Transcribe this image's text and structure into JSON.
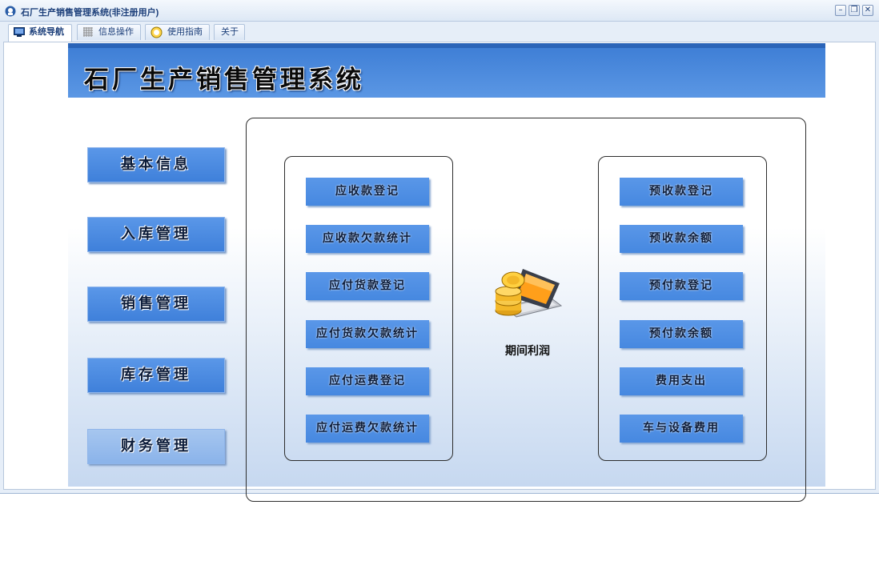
{
  "window": {
    "title": "石厂生产销售管理系统(非注册用户)",
    "controls": [
      "minimize-icon",
      "restore-icon",
      "close-icon"
    ]
  },
  "menu": {
    "tabs": [
      {
        "label": "系统导航",
        "icon": "monitor-icon",
        "active": true
      },
      {
        "label": "信息操作",
        "icon": "grid-icon",
        "active": false
      },
      {
        "label": "使用指南",
        "icon": "help-icon",
        "active": false
      },
      {
        "label": "关于",
        "icon": "",
        "active": false
      }
    ]
  },
  "banner": {
    "title": "石厂生产销售管理系统"
  },
  "sidebar": {
    "items": [
      {
        "label": "基本信息"
      },
      {
        "label": "入库管理"
      },
      {
        "label": "销售管理"
      },
      {
        "label": "库存管理"
      },
      {
        "label": "财务管理",
        "selected": true
      }
    ]
  },
  "finance": {
    "left_items": [
      {
        "label": "应收款登记"
      },
      {
        "label": "应收款欠款统计"
      },
      {
        "label": "应付货款登记"
      },
      {
        "label": "应付货款欠款统计"
      },
      {
        "label": "应付运费登记"
      },
      {
        "label": "应付运费欠款统计"
      }
    ],
    "right_items": [
      {
        "label": "预收款登记"
      },
      {
        "label": "预收款余额"
      },
      {
        "label": "预付款登记"
      },
      {
        "label": "预付款余额"
      },
      {
        "label": "费用支出"
      },
      {
        "label": "车与设备费用"
      }
    ],
    "profit": {
      "label": "期间利润",
      "icon": "laptop-coins-icon"
    }
  },
  "colors": {
    "accent": "#4a8be2",
    "banner": "#4f8fe0",
    "selected": "#9bbfee"
  }
}
